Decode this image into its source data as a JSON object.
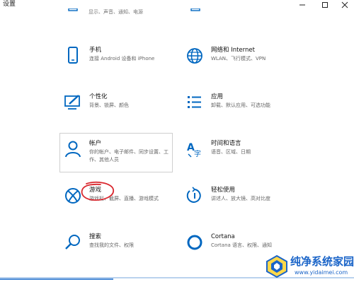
{
  "window": {
    "title": "设置",
    "controls": [
      "minimize-icon",
      "maximize-icon",
      "close-icon"
    ]
  },
  "top_partial": {
    "left_text": "显示、声音、通知、电源",
    "right_text": ""
  },
  "tiles": [
    {
      "id": "phone",
      "icon": "phone-icon",
      "title": "手机",
      "desc": "连接 Android 设备和 iPhone"
    },
    {
      "id": "network",
      "icon": "globe-icon",
      "title": "网络和 Internet",
      "desc": "WLAN、飞行模式、VPN"
    },
    {
      "id": "personalization",
      "icon": "personalization-icon",
      "title": "个性化",
      "desc": "背景、锁屏、颜色"
    },
    {
      "id": "apps",
      "icon": "apps-list-icon",
      "title": "应用",
      "desc": "卸载、默认应用、可选功能"
    },
    {
      "id": "accounts",
      "icon": "person-icon",
      "title": "帐户",
      "desc": "你的帐户、电子邮件、同步设置、工作、其他人员"
    },
    {
      "id": "time",
      "icon": "time-language-icon",
      "title": "时间和语言",
      "desc": "语音、区域、日期"
    },
    {
      "id": "gaming",
      "icon": "xbox-icon",
      "title": "游戏",
      "desc": "游戏栏、截屏、直播、游戏模式"
    },
    {
      "id": "ease",
      "icon": "ease-of-access-icon",
      "title": "轻松使用",
      "desc": "讲述人、放大镜、高对比度"
    },
    {
      "id": "search",
      "icon": "search-icon",
      "title": "搜索",
      "desc": "查找我的文件、权限"
    },
    {
      "id": "cortana",
      "icon": "cortana-icon",
      "title": "Cortana",
      "desc": "Cortana 语言、权限、通知"
    }
  ],
  "watermark": {
    "name": "纯净系统家园",
    "url": "www.yidaimei.com"
  },
  "colors": {
    "accent": "#0067c0",
    "annotation": "#d9272e"
  }
}
